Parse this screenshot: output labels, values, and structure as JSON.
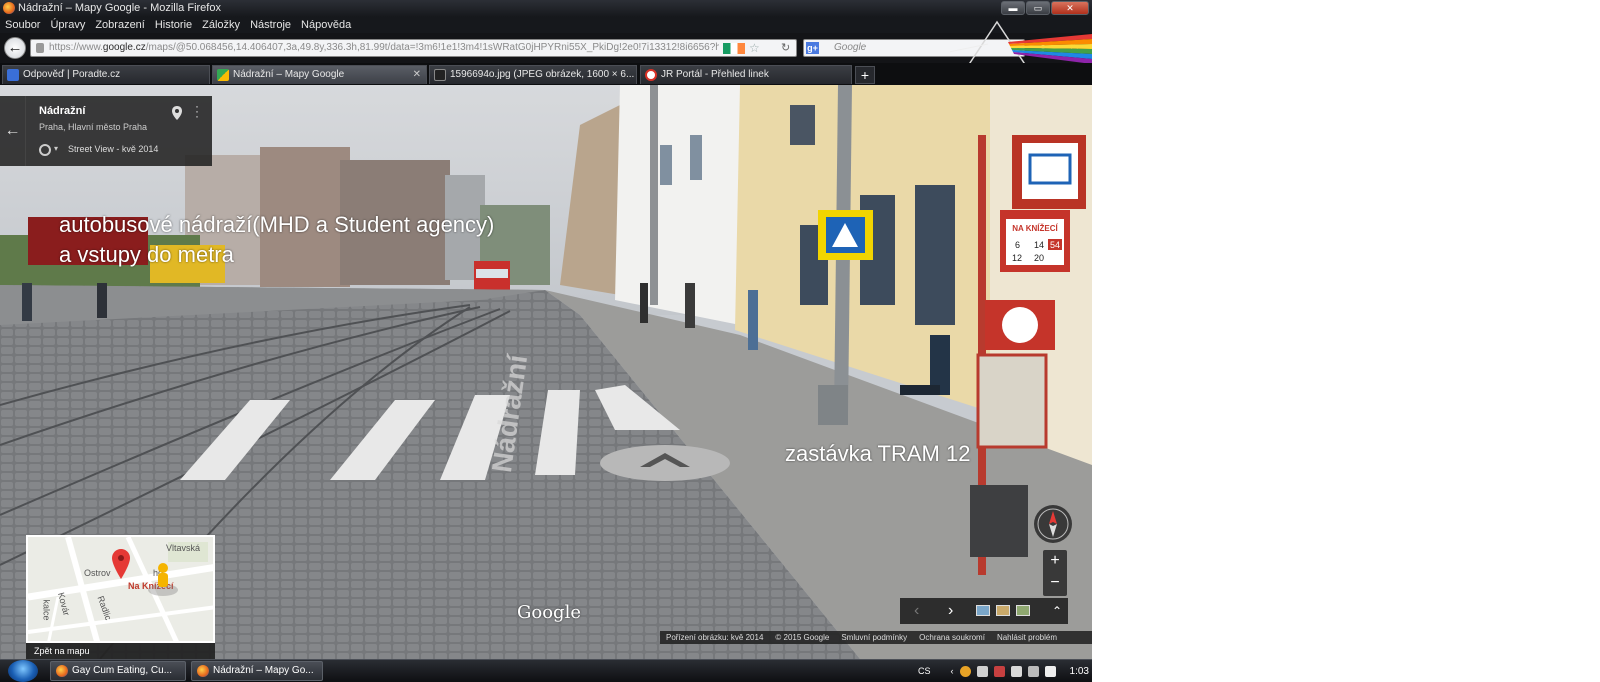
{
  "window": {
    "title": "Nádražní – Mapy Google - Mozilla Firefox",
    "buttons": {
      "minimize": "▬",
      "maximize": "▭",
      "close": "✕"
    }
  },
  "menu": [
    "Soubor",
    "Úpravy",
    "Zobrazení",
    "Historie",
    "Záložky",
    "Nástroje",
    "Nápověda"
  ],
  "nav": {
    "url_prefix": "https://www.",
    "url_domain": "google.cz",
    "url_rest": "/maps/@50.068456,14.406407,3a,49.8y,336.3h,81.99t/data=!3m6!1e1!3m4!1sWRatG0jHPYRni55X_PkiDg!2e0!7i13312!8i6656?hl=",
    "search_placeholder": "Google",
    "search_engine_badge": "g+"
  },
  "tabs": [
    {
      "label": "Odpověď | Poradte.cz",
      "icon_color": "#3a6fd8"
    },
    {
      "label": "Nádražní – Mapy Google",
      "icon_color": "#34a853",
      "active": true,
      "close": "✕"
    },
    {
      "label": "1596694o.jpg (JPEG obrázek, 1600 × 6...",
      "icon_color": "#777777"
    },
    {
      "label": "JR Portál - Přehled linek",
      "icon_color": "#d93025"
    }
  ],
  "new_tab_label": "+",
  "streetview": {
    "place_title": "Nádražní",
    "place_subtitle": "Praha, Hlavní město Praha",
    "date_label": "Street View - kvě 2014",
    "back_arrow": "←",
    "overlay_line1": "autobusové nádraží(MHD a Student agency)",
    "overlay_line2": "a vstupy do metra",
    "overlay_tram": "zastávka TRAM 12",
    "street_name": "Nádražní",
    "minimap_back": "Zpět na mapu",
    "minimap_labels": {
      "top": "Vltavská",
      "left": "Ostrov",
      "mid": "ho",
      "stop": "Na Knížecí",
      "v1": "kalce",
      "v2": "Kovár",
      "v3": "Radlic"
    },
    "google_logo": "Google",
    "zoom_in": "+",
    "zoom_out": "−",
    "film_prev": "‹",
    "film_next": "›",
    "film_expand": "⌃",
    "footer": [
      "Pořízení obrázku: kvě 2014",
      "© 2015 Google",
      "Smluvní podmínky",
      "Ochrana soukromí",
      "Nahlásit problém"
    ],
    "sign_stop_name": "NA KNÍŽECÍ",
    "sign_lines": [
      "6",
      "14",
      "54",
      "12",
      "20"
    ]
  },
  "taskbar": {
    "buttons": [
      "Gay Cum Eating, Cu...",
      "Nádražní – Mapy Go..."
    ],
    "language": "CS",
    "clock": "1:03"
  }
}
